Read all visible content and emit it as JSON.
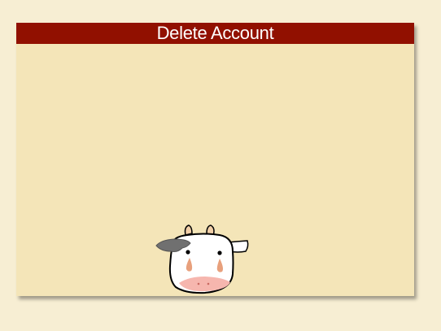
{
  "dialog": {
    "title": "Delete Account"
  },
  "colors": {
    "page_background": "#f7eed3",
    "dialog_background": "#f4e5b8",
    "title_bar": "#911000",
    "title_text": "#ffffff"
  },
  "illustration": {
    "icon": "sad-cow-icon"
  }
}
